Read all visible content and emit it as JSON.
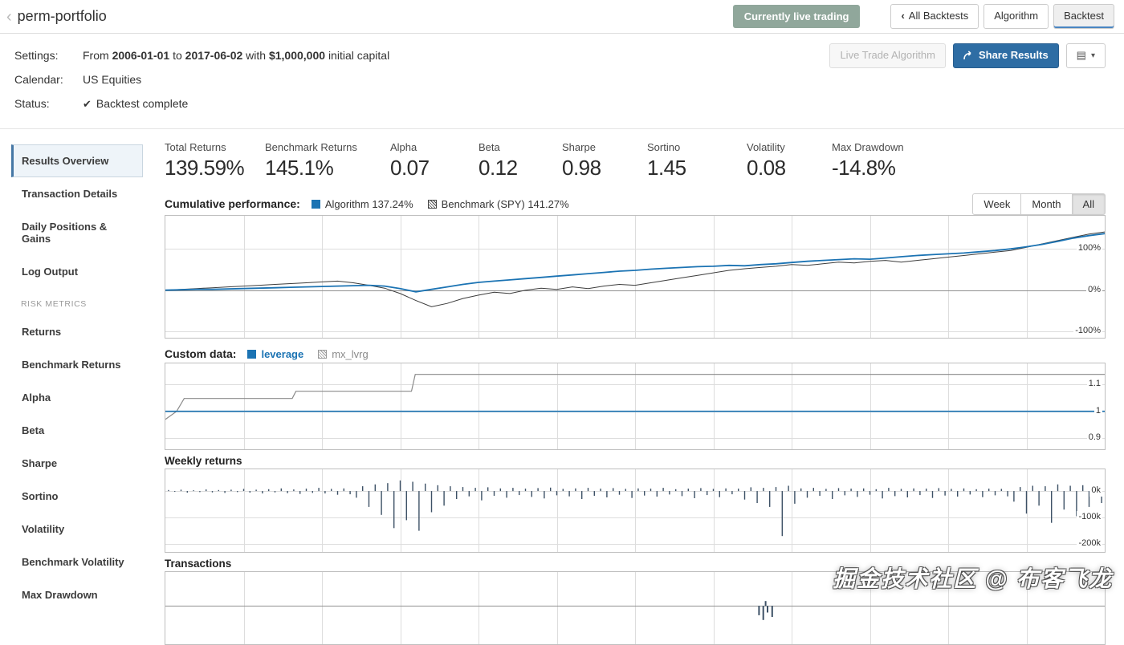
{
  "colors": {
    "accent_blue": "#1b73b3",
    "share_button_blue": "#2e6da4",
    "live_badge_green": "#90a79b",
    "benchmark_line": "#3c3c3c",
    "bar_color": "#3d5166"
  },
  "icons": {
    "back": "‹",
    "back_small": "‹",
    "check": "✔",
    "caret": "▾",
    "panel": "▤"
  },
  "header": {
    "title": "perm-portfolio",
    "live_badge": "Currently live trading",
    "all_backtests": "All Backtests",
    "algorithm_tab": "Algorithm",
    "backtest_tab": "Backtest"
  },
  "meta": {
    "settings_label": "Settings:",
    "from_word": "From",
    "start_date": "2006-01-01",
    "to_word": "to",
    "end_date": "2017-06-02",
    "with_word": "with",
    "capital": "$1,000,000",
    "capital_suffix": "initial capital",
    "calendar_label": "Calendar:",
    "calendar_value": "US Equities",
    "status_label": "Status:",
    "status_value": "Backtest complete",
    "live_trade_button": "Live Trade Algorithm",
    "share_button": "Share Results"
  },
  "sidebar": {
    "items_top": [
      "Results Overview",
      "Transaction Details",
      "Daily Positions & Gains",
      "Log Output"
    ],
    "section": "RISK METRICS",
    "items_metrics": [
      "Returns",
      "Benchmark Returns",
      "Alpha",
      "Beta",
      "Sharpe",
      "Sortino",
      "Volatility",
      "Benchmark Volatility",
      "Max Drawdown"
    ]
  },
  "stats": [
    {
      "label": "Total Returns",
      "value": "139.59%"
    },
    {
      "label": "Benchmark Returns",
      "value": "145.1%"
    },
    {
      "label": "Alpha",
      "value": "0.07"
    },
    {
      "label": "Beta",
      "value": "0.12"
    },
    {
      "label": "Sharpe",
      "value": "0.98"
    },
    {
      "label": "Sortino",
      "value": "1.45"
    },
    {
      "label": "Volatility",
      "value": "0.08"
    },
    {
      "label": "Max Drawdown",
      "value": "-14.8%"
    }
  ],
  "chart_data": [
    {
      "id": "cumulative-performance",
      "type": "line",
      "title": "Cumulative performance:",
      "legend": [
        {
          "label": "Algorithm 137.24%",
          "color": "#1b73b3"
        },
        {
          "label": "Benchmark (SPY) 141.27%",
          "color": "#3c3c3c"
        }
      ],
      "range_buttons": [
        "Week",
        "Month",
        "All"
      ],
      "active_range": "All",
      "xrange": [
        "2006-01-01",
        "2017-06-02"
      ],
      "cols": 12,
      "ylim": [
        -115,
        180
      ],
      "yticks": [
        {
          "v": 100,
          "label": "100%"
        },
        {
          "v": 0,
          "label": "0%",
          "zero": true
        },
        {
          "v": -100,
          "label": "-100%"
        }
      ],
      "series": [
        {
          "name": "Benchmark (SPY)",
          "color": "#3c3c3c",
          "width": 1,
          "values": [
            0,
            2,
            4,
            6,
            8,
            10,
            12,
            14,
            16,
            18,
            20,
            22,
            18,
            12,
            5,
            -8,
            -25,
            -40,
            -32,
            -20,
            -12,
            -5,
            -8,
            0,
            5,
            2,
            8,
            4,
            10,
            14,
            12,
            18,
            24,
            30,
            36,
            42,
            48,
            52,
            55,
            58,
            62,
            60,
            64,
            68,
            66,
            70,
            72,
            68,
            72,
            76,
            80,
            84,
            88,
            92,
            96,
            104,
            112,
            120,
            128,
            136,
            141
          ]
        },
        {
          "name": "Algorithm",
          "color": "#1b73b3",
          "width": 1.8,
          "values": [
            0,
            1,
            2,
            2,
            3,
            4,
            5,
            6,
            7,
            8,
            9,
            10,
            11,
            12,
            10,
            4,
            -4,
            2,
            8,
            14,
            19,
            22,
            25,
            28,
            31,
            34,
            37,
            40,
            43,
            46,
            48,
            51,
            53,
            55,
            57,
            58,
            60,
            59,
            62,
            64,
            67,
            70,
            72,
            74,
            76,
            75,
            78,
            81,
            84,
            86,
            88,
            90,
            93,
            96,
            100,
            105,
            111,
            118,
            126,
            132,
            137
          ]
        }
      ]
    },
    {
      "id": "custom-data",
      "type": "line",
      "title": "Custom data:",
      "legend": [
        {
          "label": "leverage",
          "color": "#1b73b3"
        },
        {
          "label": "mx_lvrg",
          "color": "#8a8a8a"
        }
      ],
      "cols": 12,
      "ylim": [
        0.858,
        1.179
      ],
      "yticks": [
        {
          "v": 1.1,
          "label": "1.1"
        },
        {
          "v": 1.0,
          "label": "1"
        },
        {
          "v": 0.9,
          "label": "0.9"
        }
      ],
      "series": [
        {
          "name": "mx_lvrg",
          "color": "#8a8a8a",
          "width": 1.2,
          "points": [
            [
              0,
              0.97
            ],
            [
              0.012,
              1.0
            ],
            [
              0.02,
              1.048
            ],
            [
              0.135,
              1.048
            ],
            [
              0.139,
              1.075
            ],
            [
              0.262,
              1.075
            ],
            [
              0.266,
              1.138
            ],
            [
              1,
              1.138
            ]
          ]
        },
        {
          "name": "leverage",
          "color": "#1b73b3",
          "width": 1.6,
          "points": [
            [
              0,
              1.0
            ],
            [
              1,
              1.0
            ]
          ]
        }
      ]
    },
    {
      "id": "weekly-returns",
      "type": "bar",
      "title": "Weekly returns",
      "cols": 12,
      "ylim": [
        -230,
        82
      ],
      "unit": "k",
      "yticks": [
        {
          "v": 0,
          "label": "0k"
        },
        {
          "v": -100,
          "label": "-100k"
        },
        {
          "v": -200,
          "label": "-200k"
        }
      ],
      "bar_color": "#3d5166",
      "values": [
        4,
        -3,
        5,
        -6,
        3,
        -4,
        6,
        -5,
        4,
        -7,
        5,
        -4,
        8,
        -6,
        5,
        -9,
        7,
        -5,
        10,
        -8,
        6,
        -11,
        9,
        -7,
        12,
        -9,
        8,
        -14,
        10,
        -12,
        -25,
        18,
        -60,
        25,
        -90,
        30,
        -140,
        40,
        -110,
        35,
        -150,
        28,
        -80,
        22,
        -55,
        18,
        -30,
        15,
        -20,
        12,
        -35,
        14,
        -18,
        10,
        -25,
        12,
        -15,
        9,
        -22,
        11,
        -28,
        13,
        -16,
        8,
        -20,
        10,
        -30,
        12,
        -18,
        9,
        -24,
        11,
        -14,
        8,
        -26,
        10,
        -17,
        9,
        -21,
        12,
        -13,
        7,
        -19,
        9,
        -27,
        11,
        -15,
        8,
        -23,
        10,
        -12,
        9,
        -32,
        14,
        -45,
        12,
        -60,
        15,
        -170,
        20,
        -48,
        10,
        -25,
        12,
        -18,
        8,
        -30,
        11,
        -16,
        9,
        -22,
        10,
        -14,
        7,
        -28,
        12,
        -19,
        8,
        -24,
        10,
        -15,
        9,
        -26,
        11,
        -17,
        8,
        -21,
        10,
        -13,
        7,
        -23,
        9,
        -16,
        8,
        -20,
        -40,
        15,
        -85,
        20,
        -55,
        18,
        -120,
        25,
        -70,
        20,
        -95,
        22,
        -60,
        18,
        -45
      ]
    },
    {
      "id": "transactions",
      "type": "bar",
      "title": "Transactions",
      "cols": 12,
      "ylim": [
        -114,
        100
      ],
      "yticks": [
        {
          "v": 0,
          "label": "",
          "zero": true
        }
      ],
      "bar_color": "#3d5166",
      "bar_points": [
        [
          0.632,
          -28
        ],
        [
          0.6365,
          -42
        ],
        [
          0.639,
          14
        ],
        [
          0.641,
          -20
        ],
        [
          0.646,
          -33
        ]
      ]
    }
  ],
  "watermark": "掘金技术社区 @ 布客飞龙"
}
